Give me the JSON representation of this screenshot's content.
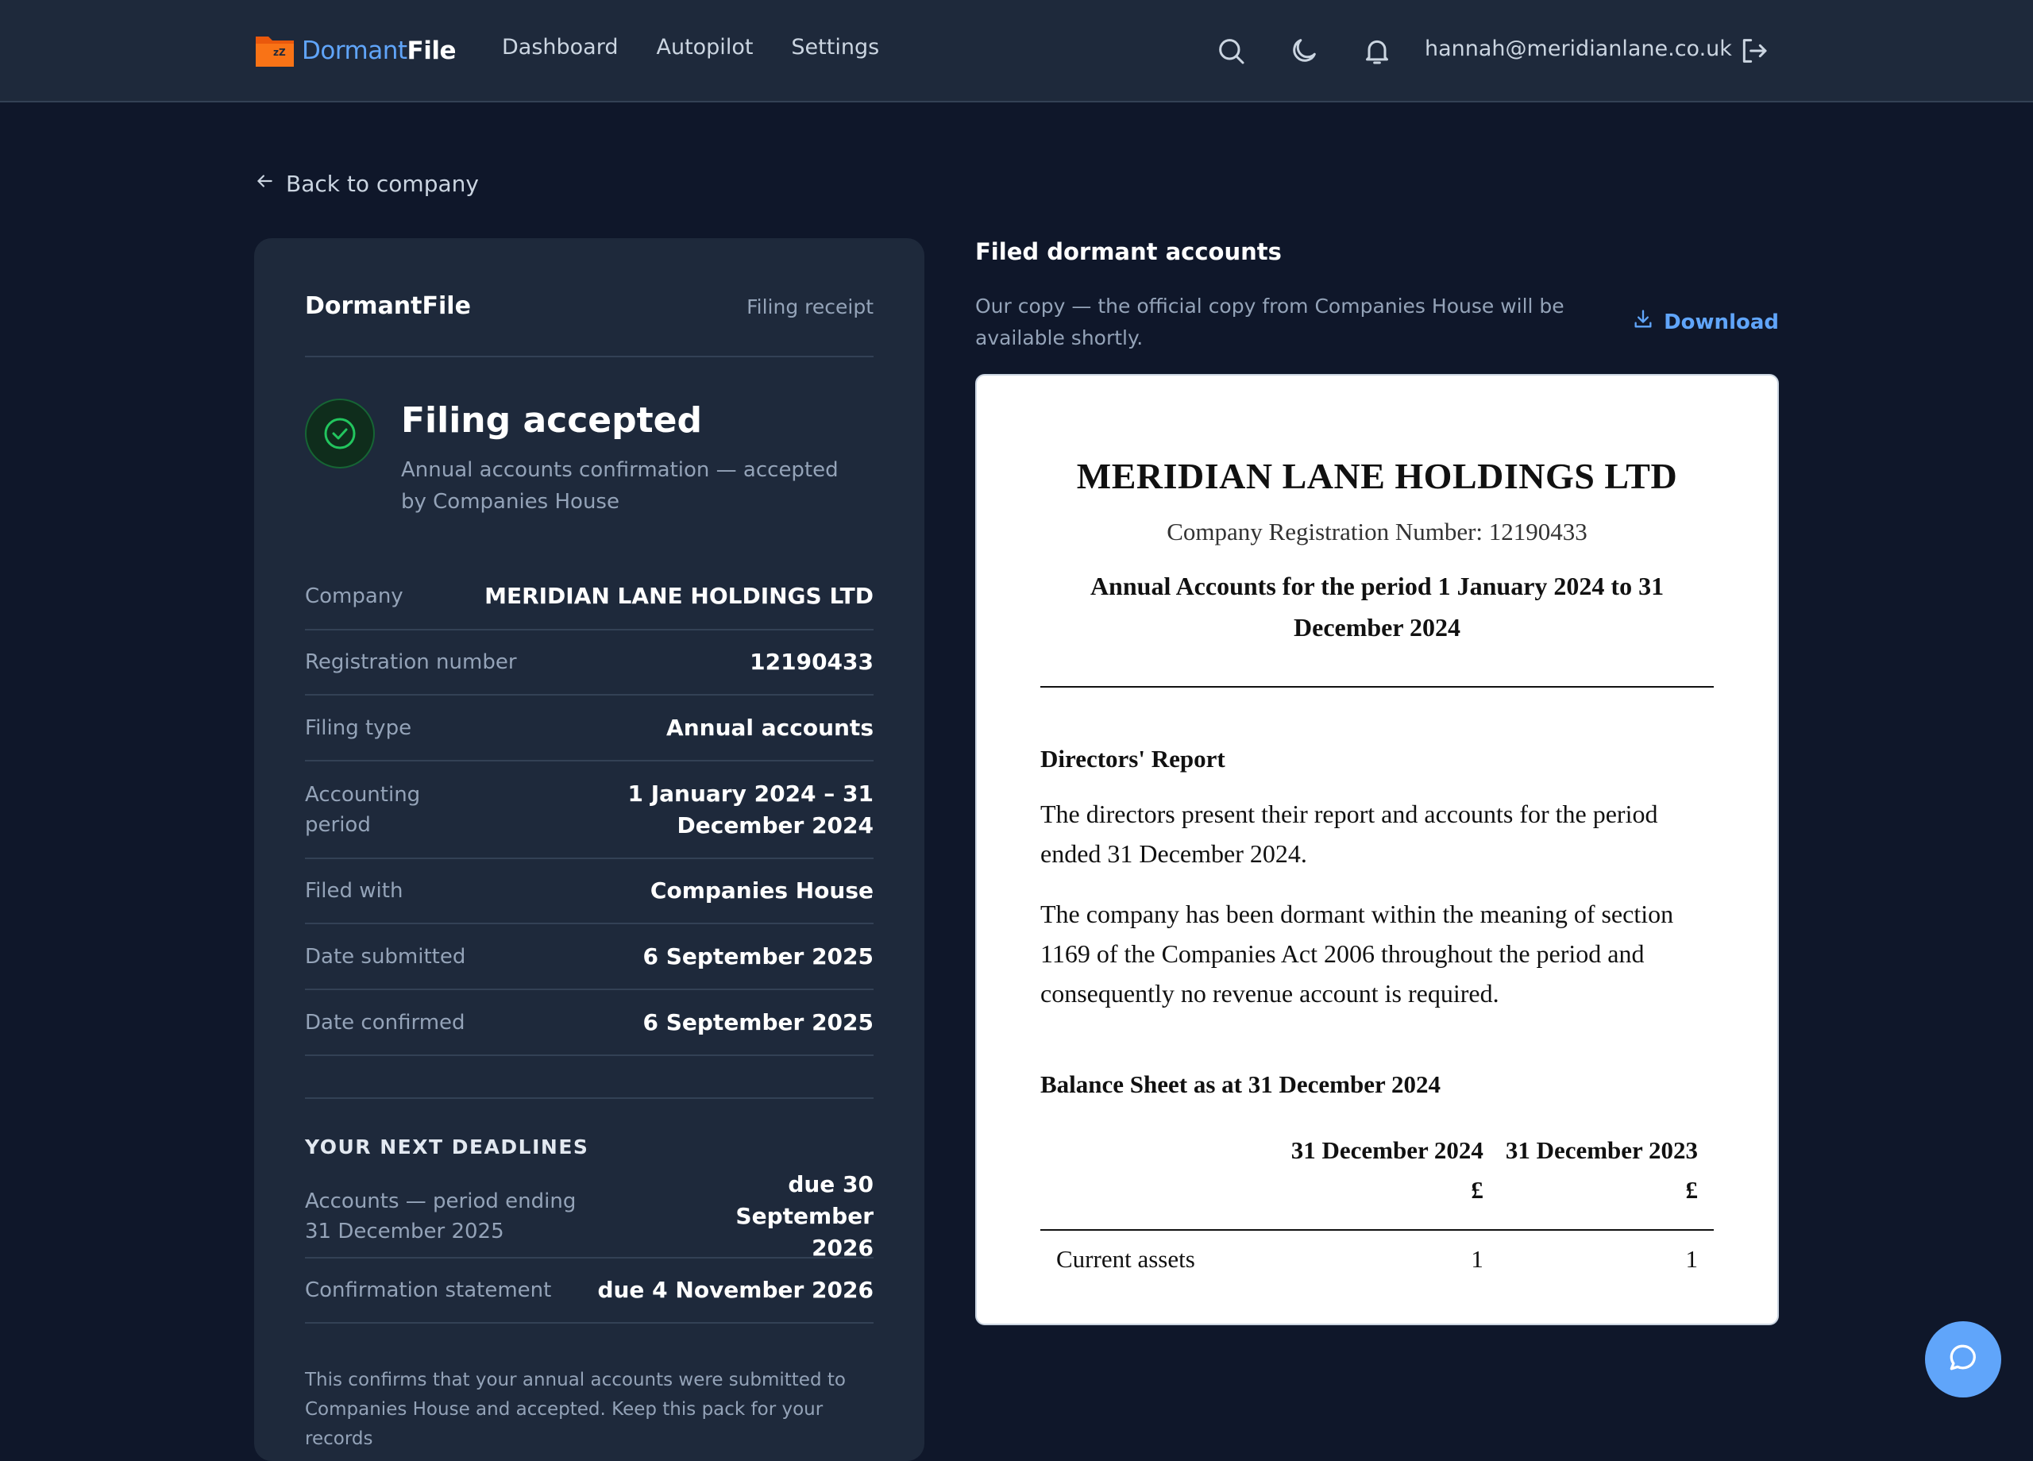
{
  "header": {
    "brand_part1": "Dormant",
    "brand_part2": "File",
    "nav": [
      "Dashboard",
      "Autopilot",
      "Settings"
    ],
    "user_email": "hannah@meridianlane.co.uk",
    "icons": [
      "folder-logo-icon",
      "search-icon",
      "moon-icon",
      "bell-icon",
      "logout-icon"
    ]
  },
  "back_link": "Back to company",
  "receipt": {
    "brand": "DormantFile",
    "label": "Filing receipt",
    "status_title": "Filing accepted",
    "status_subtitle": "Annual accounts confirmation — accepted by Companies House",
    "details": [
      {
        "key": "Company",
        "value": "MERIDIAN LANE HOLDINGS LTD"
      },
      {
        "key": "Registration number",
        "value": "12190433"
      },
      {
        "key": "Filing type",
        "value": "Annual accounts"
      },
      {
        "key": "Accounting period",
        "value": "1 January 2024 – 31 December 2024"
      },
      {
        "key": "Filed with",
        "value": "Companies House"
      },
      {
        "key": "Date submitted",
        "value": "6 September 2025"
      },
      {
        "key": "Date confirmed",
        "value": "6 September 2025"
      }
    ],
    "deadlines_title": "YOUR NEXT DEADLINES",
    "deadlines": [
      {
        "key": "Accounts — period ending 31 December 2025",
        "value": "due 30 September 2026"
      },
      {
        "key": "Confirmation statement",
        "value": "due 4 November 2026"
      }
    ],
    "note": "This confirms that your annual accounts were submitted to Companies House and accepted. Keep this pack for your records"
  },
  "filed_accounts": {
    "title": "Filed dormant accounts",
    "subtitle": "Our copy — the official copy from Companies House will be available shortly.",
    "download_label": "Download"
  },
  "document": {
    "company": "MERIDIAN LANE HOLDINGS LTD",
    "registration": "Company Registration Number: 12190433",
    "period": "Annual Accounts for the period 1 January 2024 to 31 December 2024",
    "directors_heading": "Directors' Report",
    "para1": "The directors present their report and accounts for the period ended 31 December 2024.",
    "para2": "The company has been dormant within the meaning of section 1169 of the Companies Act 2006 throughout the period and consequently no revenue account is required.",
    "balance_heading": "Balance Sheet as at 31 December 2024",
    "col1": "31 December 2024",
    "col2": "31 December 2023",
    "currency": "£",
    "rows": [
      {
        "label": "Current assets",
        "v1": "1",
        "v2": "1"
      }
    ]
  },
  "colors": {
    "page_bg": "#0f172a",
    "panel_bg": "#1e293b",
    "accent": "#60a5fa",
    "success": "#22c55e",
    "logo_orange": "#f97316"
  }
}
